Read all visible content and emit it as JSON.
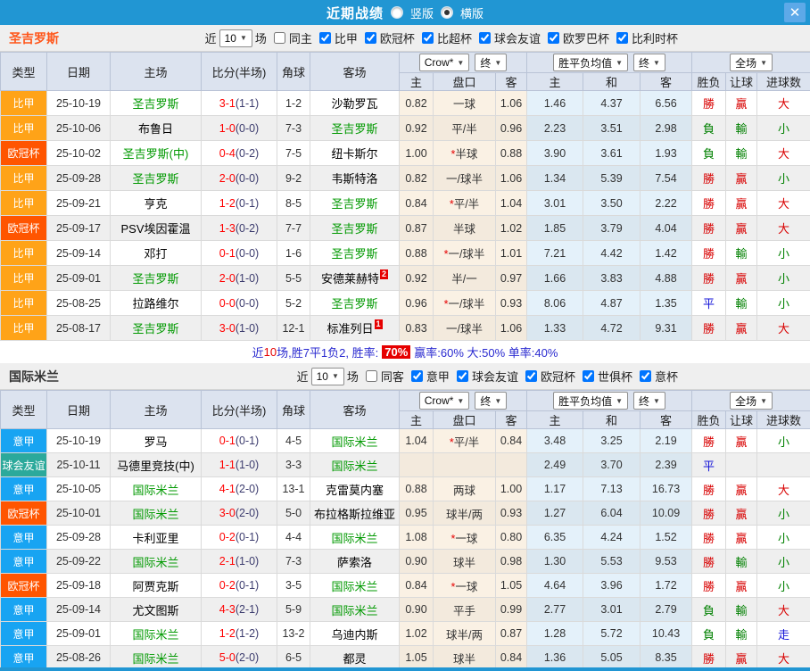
{
  "titlebar": {
    "title": "近期战绩",
    "vertical_label": "竖版",
    "horizontal_label": "横版",
    "selected": "横版",
    "close_glyph": "✕"
  },
  "table_header": {
    "main": [
      "类型",
      "日期",
      "主场",
      "比分(半场)",
      "角球",
      "客场"
    ],
    "crow_select": "Crow*",
    "final_select": "终",
    "avg_select": "胜平负均值",
    "full_select": "全场",
    "sub": [
      "主",
      "盘口",
      "客",
      "主",
      "和",
      "客",
      "胜负",
      "让球",
      "进球数"
    ]
  },
  "row_fields": [
    "league",
    "date",
    "home",
    "home_is_focus",
    "ft_score",
    "ht_score",
    "corners",
    "away",
    "away_is_focus",
    "away_badge",
    "crow_home",
    "handicap",
    "crow_away",
    "avg_home",
    "avg_draw",
    "avg_away",
    "result",
    "handicap_result",
    "goals"
  ],
  "colors": {
    "titlebar_blue": "#2196d3",
    "league": {
      "比甲": "#ffa318",
      "欧冠杯": "#ff5500",
      "意甲": "#18a4f2",
      "球会友谊": "#2ba99b"
    },
    "result": {
      "勝": "#d80000",
      "負": "#008000",
      "平": "#1414d8",
      "贏": "#d80000",
      "輸": "#008000",
      "走": "#1414d8",
      "大": "#d80000",
      "小": "#008000"
    },
    "focus_team_green": "#009900",
    "ft_score_red": "#ff0000",
    "ht_score": "#3c3c6e"
  },
  "sections": [
    {
      "team": "圣吉罗斯",
      "team_color": "#ff5519",
      "filter": {
        "near": "近",
        "count": "10",
        "unit": "场",
        "same_label": "同主",
        "same_checked": false,
        "leagues": [
          {
            "label": "比甲",
            "checked": true
          },
          {
            "label": "欧冠杯",
            "checked": true
          },
          {
            "label": "比超杯",
            "checked": true
          },
          {
            "label": "球会友谊",
            "checked": true
          },
          {
            "label": "欧罗巴杯",
            "checked": true
          },
          {
            "label": "比利时杯",
            "checked": true
          }
        ]
      },
      "rows": [
        [
          "比甲",
          "25-10-19",
          "圣吉罗斯",
          true,
          "3-1",
          "(1-1)",
          "1-2",
          "沙勒罗瓦",
          false,
          "",
          "0.82",
          "一球",
          "1.06",
          "1.46",
          "4.37",
          "6.56",
          "勝",
          "贏",
          "大"
        ],
        [
          "比甲",
          "25-10-06",
          "布鲁日",
          false,
          "1-0",
          "(0-0)",
          "7-3",
          "圣吉罗斯",
          true,
          "",
          "0.92",
          "平/半",
          "0.96",
          "2.23",
          "3.51",
          "2.98",
          "負",
          "輸",
          "小"
        ],
        [
          "欧冠杯",
          "25-10-02",
          "圣吉罗斯(中)",
          true,
          "0-4",
          "(0-2)",
          "7-5",
          "纽卡斯尔",
          false,
          "",
          "1.00",
          "*半球",
          "0.88",
          "3.90",
          "3.61",
          "1.93",
          "負",
          "輸",
          "大"
        ],
        [
          "比甲",
          "25-09-28",
          "圣吉罗斯",
          true,
          "2-0",
          "(0-0)",
          "9-2",
          "韦斯特洛",
          false,
          "",
          "0.82",
          "一/球半",
          "1.06",
          "1.34",
          "5.39",
          "7.54",
          "勝",
          "贏",
          "小"
        ],
        [
          "比甲",
          "25-09-21",
          "亨克",
          false,
          "1-2",
          "(0-1)",
          "8-5",
          "圣吉罗斯",
          true,
          "",
          "0.84",
          "*平/半",
          "1.04",
          "3.01",
          "3.50",
          "2.22",
          "勝",
          "贏",
          "大"
        ],
        [
          "欧冠杯",
          "25-09-17",
          "PSV埃因霍温",
          false,
          "1-3",
          "(0-2)",
          "7-7",
          "圣吉罗斯",
          true,
          "",
          "0.87",
          "半球",
          "1.02",
          "1.85",
          "3.79",
          "4.04",
          "勝",
          "贏",
          "大"
        ],
        [
          "比甲",
          "25-09-14",
          "邓打",
          false,
          "0-1",
          "(0-0)",
          "1-6",
          "圣吉罗斯",
          true,
          "",
          "0.88",
          "*一/球半",
          "1.01",
          "7.21",
          "4.42",
          "1.42",
          "勝",
          "輸",
          "小"
        ],
        [
          "比甲",
          "25-09-01",
          "圣吉罗斯",
          true,
          "2-0",
          "(1-0)",
          "5-5",
          "安德莱赫特",
          false,
          "2",
          "0.92",
          "半/一",
          "0.97",
          "1.66",
          "3.83",
          "4.88",
          "勝",
          "贏",
          "小"
        ],
        [
          "比甲",
          "25-08-25",
          "拉路维尔",
          false,
          "0-0",
          "(0-0)",
          "5-2",
          "圣吉罗斯",
          true,
          "",
          "0.96",
          "*一/球半",
          "0.93",
          "8.06",
          "4.87",
          "1.35",
          "平",
          "輸",
          "小"
        ],
        [
          "比甲",
          "25-08-17",
          "圣吉罗斯",
          true,
          "3-0",
          "(1-0)",
          "12-1",
          "标准列日",
          false,
          "1",
          "0.83",
          "一/球半",
          "1.06",
          "1.33",
          "4.72",
          "9.31",
          "勝",
          "贏",
          "大"
        ]
      ],
      "summary": {
        "prefix": "近",
        "count": "10",
        "mid": "场,胜7平1负2, 胜率:",
        "rate": "70%",
        "suffix": "赢率:60% 大:50% 单率:40%"
      }
    },
    {
      "team": "国际米兰",
      "team_color": "#333333",
      "filter": {
        "near": "近",
        "count": "10",
        "unit": "场",
        "same_label": "同客",
        "same_checked": false,
        "leagues": [
          {
            "label": "意甲",
            "checked": true
          },
          {
            "label": "球会友谊",
            "checked": true
          },
          {
            "label": "欧冠杯",
            "checked": true
          },
          {
            "label": "世俱杯",
            "checked": true
          },
          {
            "label": "意杯",
            "checked": true
          }
        ]
      },
      "rows": [
        [
          "意甲",
          "25-10-19",
          "罗马",
          false,
          "0-1",
          "(0-1)",
          "4-5",
          "国际米兰",
          true,
          "",
          "1.04",
          "*平/半",
          "0.84",
          "3.48",
          "3.25",
          "2.19",
          "勝",
          "贏",
          "小"
        ],
        [
          "球会友谊",
          "25-10-11",
          "马德里竞技(中)",
          false,
          "1-1",
          "(1-0)",
          "3-3",
          "国际米兰",
          true,
          "",
          "",
          "",
          "",
          "2.49",
          "3.70",
          "2.39",
          "平",
          "",
          ""
        ],
        [
          "意甲",
          "25-10-05",
          "国际米兰",
          true,
          "4-1",
          "(2-0)",
          "13-1",
          "克雷莫内塞",
          false,
          "",
          "0.88",
          "两球",
          "1.00",
          "1.17",
          "7.13",
          "16.73",
          "勝",
          "贏",
          "大"
        ],
        [
          "欧冠杯",
          "25-10-01",
          "国际米兰",
          true,
          "3-0",
          "(2-0)",
          "5-0",
          "布拉格斯拉维亚",
          false,
          "",
          "0.95",
          "球半/两",
          "0.93",
          "1.27",
          "6.04",
          "10.09",
          "勝",
          "贏",
          "小"
        ],
        [
          "意甲",
          "25-09-28",
          "卡利亚里",
          false,
          "0-2",
          "(0-1)",
          "4-4",
          "国际米兰",
          true,
          "",
          "1.08",
          "*一球",
          "0.80",
          "6.35",
          "4.24",
          "1.52",
          "勝",
          "贏",
          "小"
        ],
        [
          "意甲",
          "25-09-22",
          "国际米兰",
          true,
          "2-1",
          "(1-0)",
          "7-3",
          "萨索洛",
          false,
          "",
          "0.90",
          "球半",
          "0.98",
          "1.30",
          "5.53",
          "9.53",
          "勝",
          "輸",
          "小"
        ],
        [
          "欧冠杯",
          "25-09-18",
          "阿贾克斯",
          false,
          "0-2",
          "(0-1)",
          "3-5",
          "国际米兰",
          true,
          "",
          "0.84",
          "*一球",
          "1.05",
          "4.64",
          "3.96",
          "1.72",
          "勝",
          "贏",
          "小"
        ],
        [
          "意甲",
          "25-09-14",
          "尤文图斯",
          false,
          "4-3",
          "(2-1)",
          "5-9",
          "国际米兰",
          true,
          "",
          "0.90",
          "平手",
          "0.99",
          "2.77",
          "3.01",
          "2.79",
          "負",
          "輸",
          "大"
        ],
        [
          "意甲",
          "25-09-01",
          "国际米兰",
          true,
          "1-2",
          "(1-2)",
          "13-2",
          "乌迪内斯",
          false,
          "",
          "1.02",
          "球半/两",
          "0.87",
          "1.28",
          "5.72",
          "10.43",
          "負",
          "輸",
          "走"
        ],
        [
          "意甲",
          "25-08-26",
          "国际米兰",
          true,
          "5-0",
          "(2-0)",
          "6-5",
          "都灵",
          false,
          "",
          "1.05",
          "球半",
          "0.84",
          "1.36",
          "5.05",
          "8.35",
          "勝",
          "贏",
          "大"
        ]
      ],
      "summary": null
    }
  ]
}
